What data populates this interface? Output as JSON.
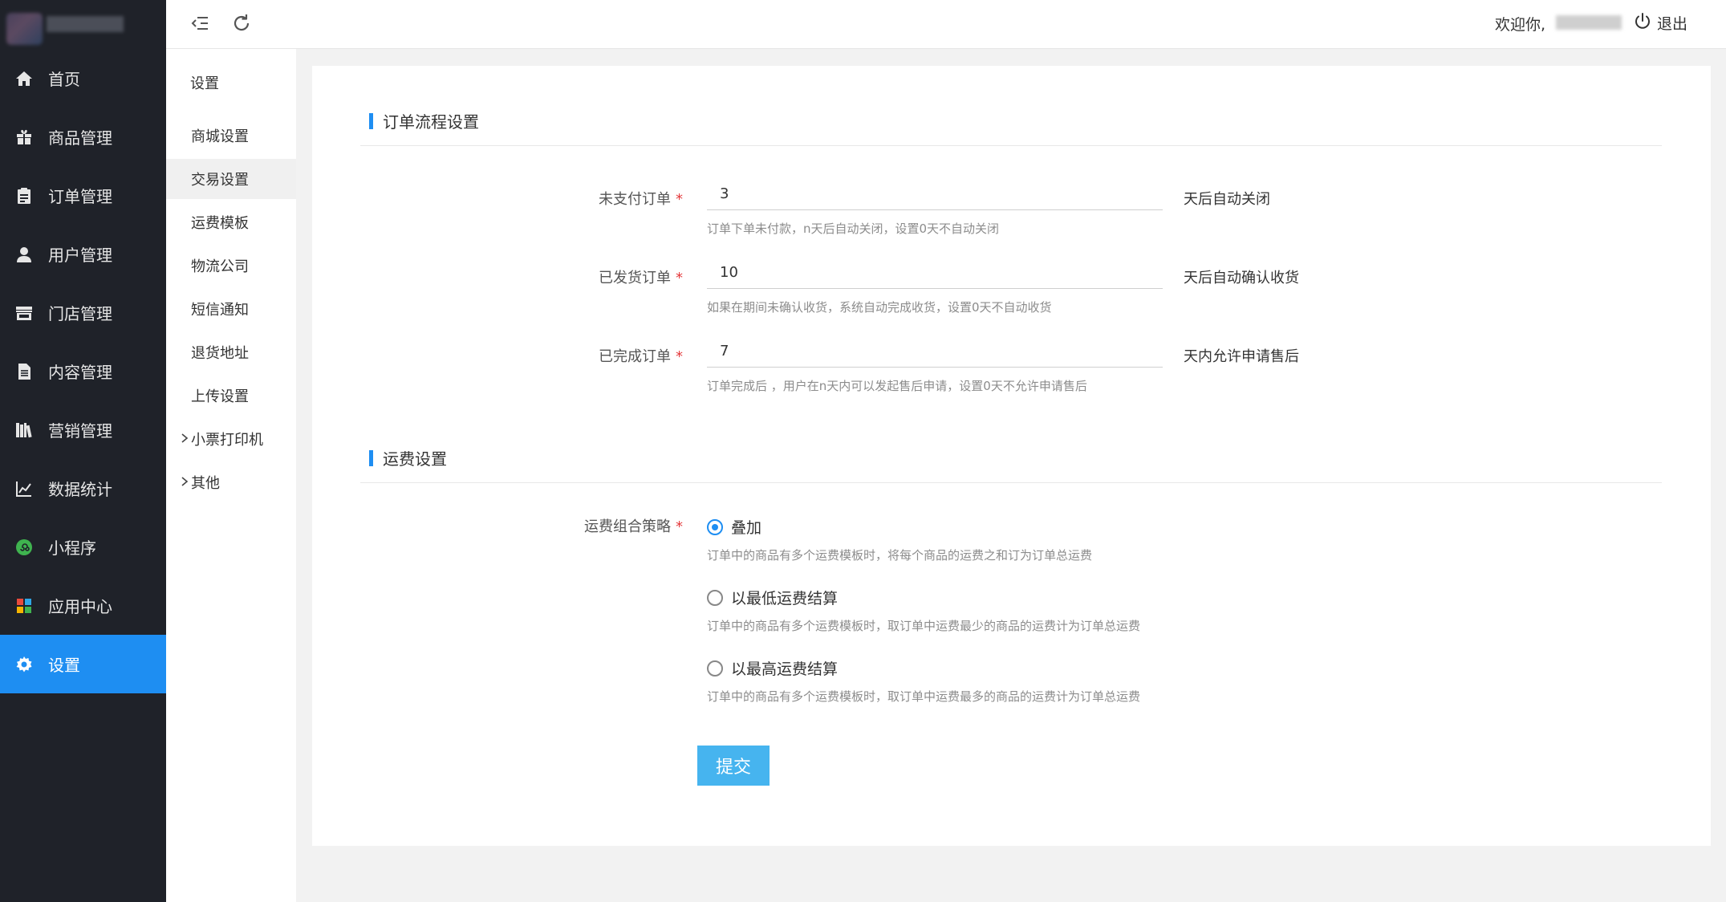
{
  "sidebar": {
    "items": [
      {
        "label": "首页",
        "icon": "home-icon"
      },
      {
        "label": "商品管理",
        "icon": "gift-icon"
      },
      {
        "label": "订单管理",
        "icon": "clipboard-icon"
      },
      {
        "label": "用户管理",
        "icon": "user-icon"
      },
      {
        "label": "门店管理",
        "icon": "store-icon"
      },
      {
        "label": "内容管理",
        "icon": "document-icon"
      },
      {
        "label": "营销管理",
        "icon": "books-icon"
      },
      {
        "label": "数据统计",
        "icon": "line-chart-icon"
      },
      {
        "label": "小程序",
        "icon": "mini-program-icon"
      },
      {
        "label": "应用中心",
        "icon": "apps-icon"
      },
      {
        "label": "设置",
        "icon": "gear-icon"
      }
    ],
    "active_index": 10,
    "active_color": "#1e8ef2"
  },
  "submenu": {
    "title": "设置",
    "items": [
      {
        "label": "商城设置",
        "expandable": false
      },
      {
        "label": "交易设置",
        "expandable": false
      },
      {
        "label": "运费模板",
        "expandable": false
      },
      {
        "label": "物流公司",
        "expandable": false
      },
      {
        "label": "短信通知",
        "expandable": false
      },
      {
        "label": "退货地址",
        "expandable": false
      },
      {
        "label": "上传设置",
        "expandable": false
      },
      {
        "label": "小票打印机",
        "expandable": true
      },
      {
        "label": "其他",
        "expandable": true
      }
    ],
    "active_index": 1
  },
  "header": {
    "welcome": "欢迎你,",
    "logout": "退出"
  },
  "order_section": {
    "title": "订单流程设置",
    "fields": [
      {
        "label": "未支付订单",
        "value": "3",
        "unit": "天后自动关闭",
        "hint": "订单下单未付款，n天后自动关闭，设置0天不自动关闭"
      },
      {
        "label": "已发货订单",
        "value": "10",
        "unit": "天后自动确认收货",
        "hint": "如果在期间未确认收货，系统自动完成收货，设置0天不自动收货"
      },
      {
        "label": "已完成订单",
        "value": "7",
        "unit": "天内允许申请售后",
        "hint": "订单完成后 ，用户在n天内可以发起售后申请，设置0天不允许申请售后"
      }
    ]
  },
  "freight_section": {
    "title": "运费设置",
    "strategy_label": "运费组合策略",
    "options": [
      {
        "label": "叠加",
        "hint": "订单中的商品有多个运费模板时，将每个商品的运费之和订为订单总运费",
        "checked": true
      },
      {
        "label": "以最低运费结算",
        "hint": "订单中的商品有多个运费模板时，取订单中运费最少的商品的运费计为订单总运费",
        "checked": false
      },
      {
        "label": "以最高运费结算",
        "hint": "订单中的商品有多个运费模板时，取订单中运费最多的商品的运费计为订单总运费",
        "checked": false
      }
    ]
  },
  "submit_label": "提交",
  "required_mark": "*"
}
